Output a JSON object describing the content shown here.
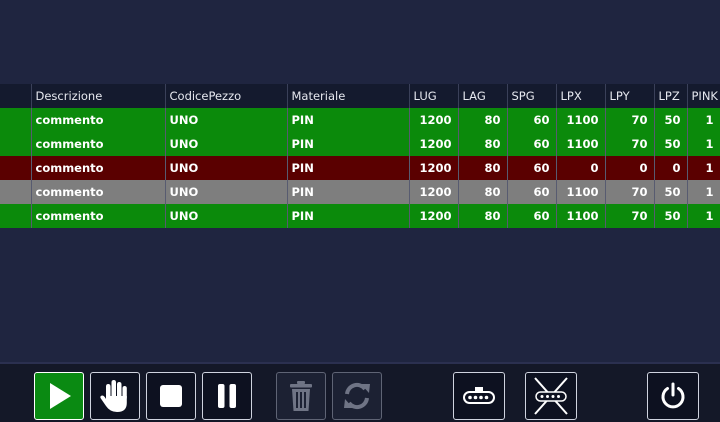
{
  "table": {
    "columns": [
      "",
      "Descrizione",
      "CodicePezzo",
      "Materiale",
      "LUG",
      "LAG",
      "SPG",
      "LPX",
      "LPY",
      "LPZ",
      "PINK"
    ],
    "rows": [
      {
        "status": "green",
        "cells": [
          "",
          "commento",
          "UNO",
          "PIN",
          "1200",
          "80",
          "60",
          "1100",
          "70",
          "50",
          "1"
        ]
      },
      {
        "status": "green",
        "cells": [
          "",
          "commento",
          "UNO",
          "PIN",
          "1200",
          "80",
          "60",
          "1100",
          "70",
          "50",
          "1"
        ]
      },
      {
        "status": "red",
        "cells": [
          "",
          "commento",
          "UNO",
          "PIN",
          "1200",
          "80",
          "60",
          "0",
          "0",
          "0",
          "1"
        ]
      },
      {
        "status": "gray",
        "cells": [
          "",
          "commento",
          "UNO",
          "PIN",
          "1200",
          "80",
          "60",
          "1100",
          "70",
          "50",
          "1"
        ]
      },
      {
        "status": "green",
        "cells": [
          "",
          "commento",
          "UNO",
          "PIN",
          "1200",
          "80",
          "60",
          "1100",
          "70",
          "50",
          "1"
        ]
      }
    ],
    "row_colors": {
      "green": "#0b8a0b",
      "red": "#5a0000",
      "gray": "#7e7e7e"
    }
  },
  "toolbar": {
    "buttons": [
      {
        "name": "play-icon",
        "enabled": true
      },
      {
        "name": "hand-stop-icon",
        "enabled": true
      },
      {
        "name": "stop-icon",
        "enabled": true
      },
      {
        "name": "pause-icon",
        "enabled": true
      },
      {
        "name": "trash-icon",
        "enabled": false
      },
      {
        "name": "refresh-icon",
        "enabled": false
      },
      {
        "name": "conveyor-icon",
        "enabled": true
      },
      {
        "name": "conveyor-disabled-icon",
        "enabled": true
      },
      {
        "name": "power-icon",
        "enabled": true
      }
    ]
  },
  "colors": {
    "background": "#1f2540",
    "header": "#141a2e",
    "play_button": "#0a8a12"
  }
}
